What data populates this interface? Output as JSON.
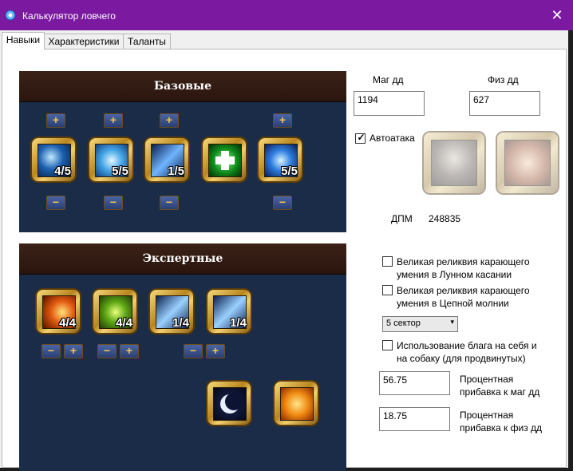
{
  "window": {
    "title": "Калькулятор ловчего",
    "close_glyph": "✕",
    "accent": "#7b1aa0"
  },
  "tabs": [
    {
      "label": "Навыки",
      "active": true
    },
    {
      "label": "Характеристики",
      "active": false
    },
    {
      "label": "Таланты",
      "active": false
    }
  ],
  "basic": {
    "header": "Базовые",
    "skills": [
      {
        "icon": "claw-strike-icon",
        "level": "4/5"
      },
      {
        "icon": "ice-burst-icon",
        "level": "5/5"
      },
      {
        "icon": "shard-strike-icon",
        "level": "1/5"
      },
      {
        "icon": "healing-cross-icon",
        "level": ""
      },
      {
        "icon": "chain-lightning-icon",
        "level": "5/5"
      }
    ]
  },
  "expert": {
    "header": "Экспертные",
    "skills": [
      {
        "icon": "flame-icon",
        "level": "4/4"
      },
      {
        "icon": "nature-icon",
        "level": "4/4"
      },
      {
        "icon": "blade-icon",
        "level": "1/4"
      },
      {
        "icon": "blade-icon",
        "level": "1/4"
      }
    ],
    "extra": [
      {
        "icon": "crescent-moon-icon"
      },
      {
        "icon": "golden-feather-icon"
      }
    ]
  },
  "buttons": {
    "plus": "+",
    "minus": "−"
  },
  "stats": {
    "mag_label": "Маг дд",
    "mag_value": "1194",
    "phys_label": "Физ дд",
    "phys_value": "627",
    "autoattack_label": "Автоатака",
    "autoattack_checked": true,
    "dpm_label": "ДПМ",
    "dpm_value": "248835"
  },
  "options": {
    "relic_moon": "Великая реликвия карающего умения в Лунном касании",
    "relic_chain": "Великая реликвия карающего умения в Цепной молнии",
    "sector_selected": "5 сектор",
    "blessing": "Использование блага на себя и на собаку (для продвинутых)",
    "mag_pct_label": "Процентная прибавка к маг дд",
    "mag_pct_value": "56.75",
    "phys_pct_label": "Процентная прибавка к физ дд",
    "phys_pct_value": "18.75"
  }
}
